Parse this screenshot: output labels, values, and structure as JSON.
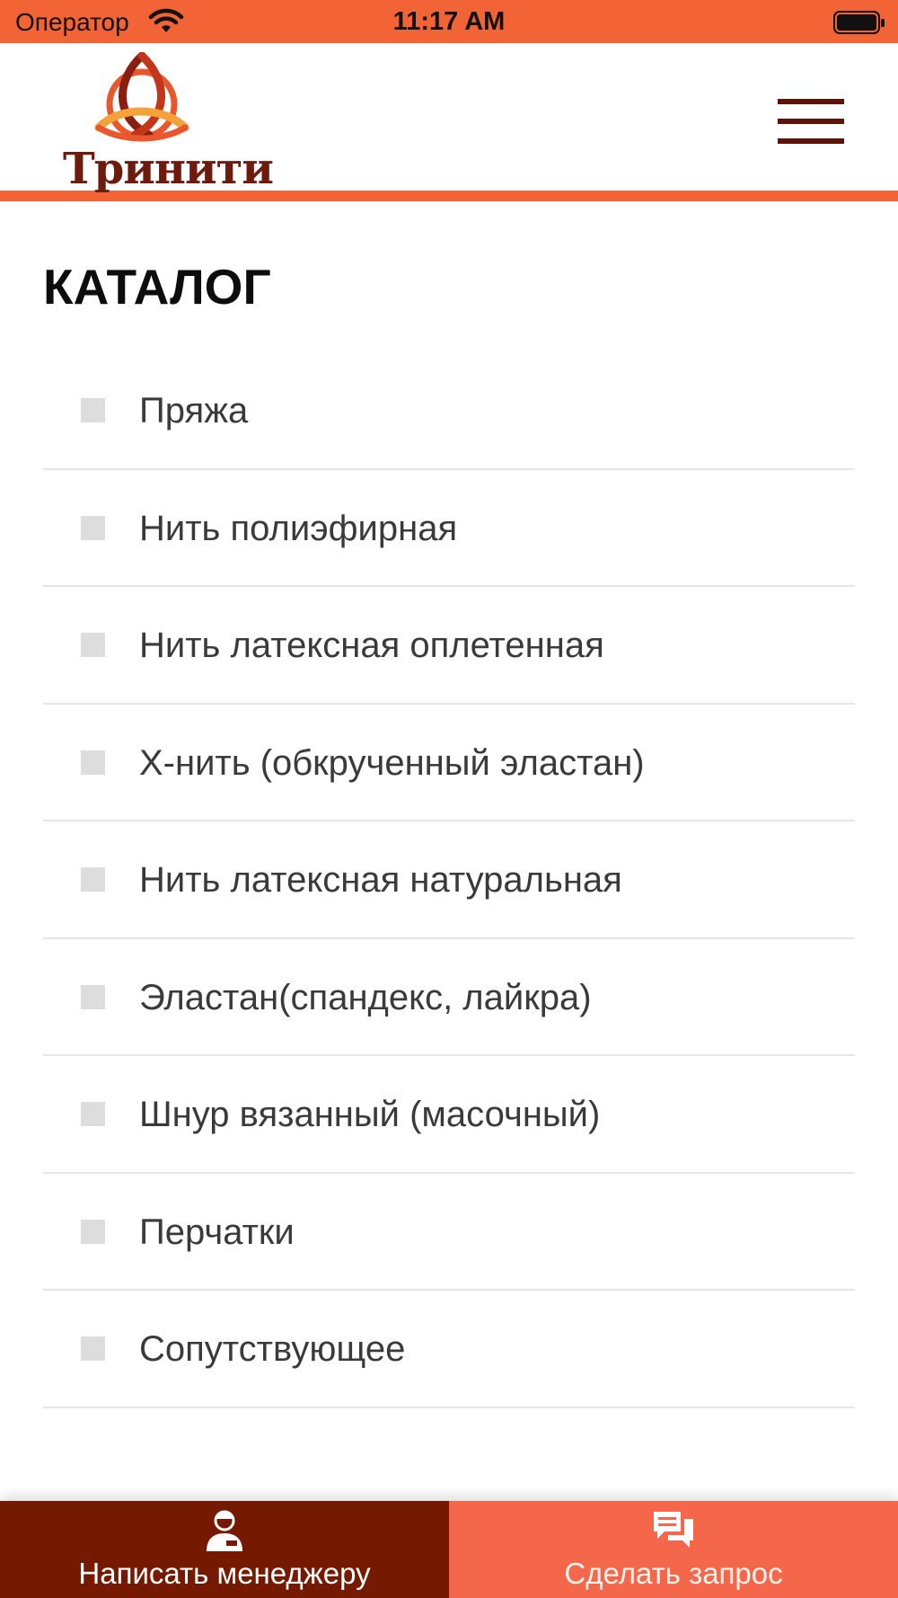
{
  "status_bar": {
    "carrier": "Оператор",
    "time": "11:17 AM",
    "icons": [
      "wifi-icon",
      "battery-icon"
    ]
  },
  "header": {
    "logo_text": "Тринити",
    "menu_icon": "hamburger-icon"
  },
  "main": {
    "title": "КАТАЛОГ",
    "items": [
      {
        "label": "Пряжа"
      },
      {
        "label": "Нить полиэфирная"
      },
      {
        "label": "Нить латексная оплетенная"
      },
      {
        "label": "Х-нить (обкрученный эластан)"
      },
      {
        "label": "Нить латексная натуральная"
      },
      {
        "label": "Эластан(спандекс, лайкра)"
      },
      {
        "label": "Шнур вязанный (масочный)"
      },
      {
        "label": "Перчатки"
      },
      {
        "label": "Сопутствующее"
      }
    ]
  },
  "bottom_bar": {
    "manager": {
      "label": "Написать менеджеру",
      "icon": "manager-icon"
    },
    "request": {
      "label": "Сделать запрос",
      "icon": "chat-icon"
    }
  },
  "colors": {
    "accent": "#f26336",
    "brand_dark": "#751a00",
    "request_bg": "#f4674a",
    "bullet": "#dddddd",
    "divider": "#e6e6e6"
  }
}
